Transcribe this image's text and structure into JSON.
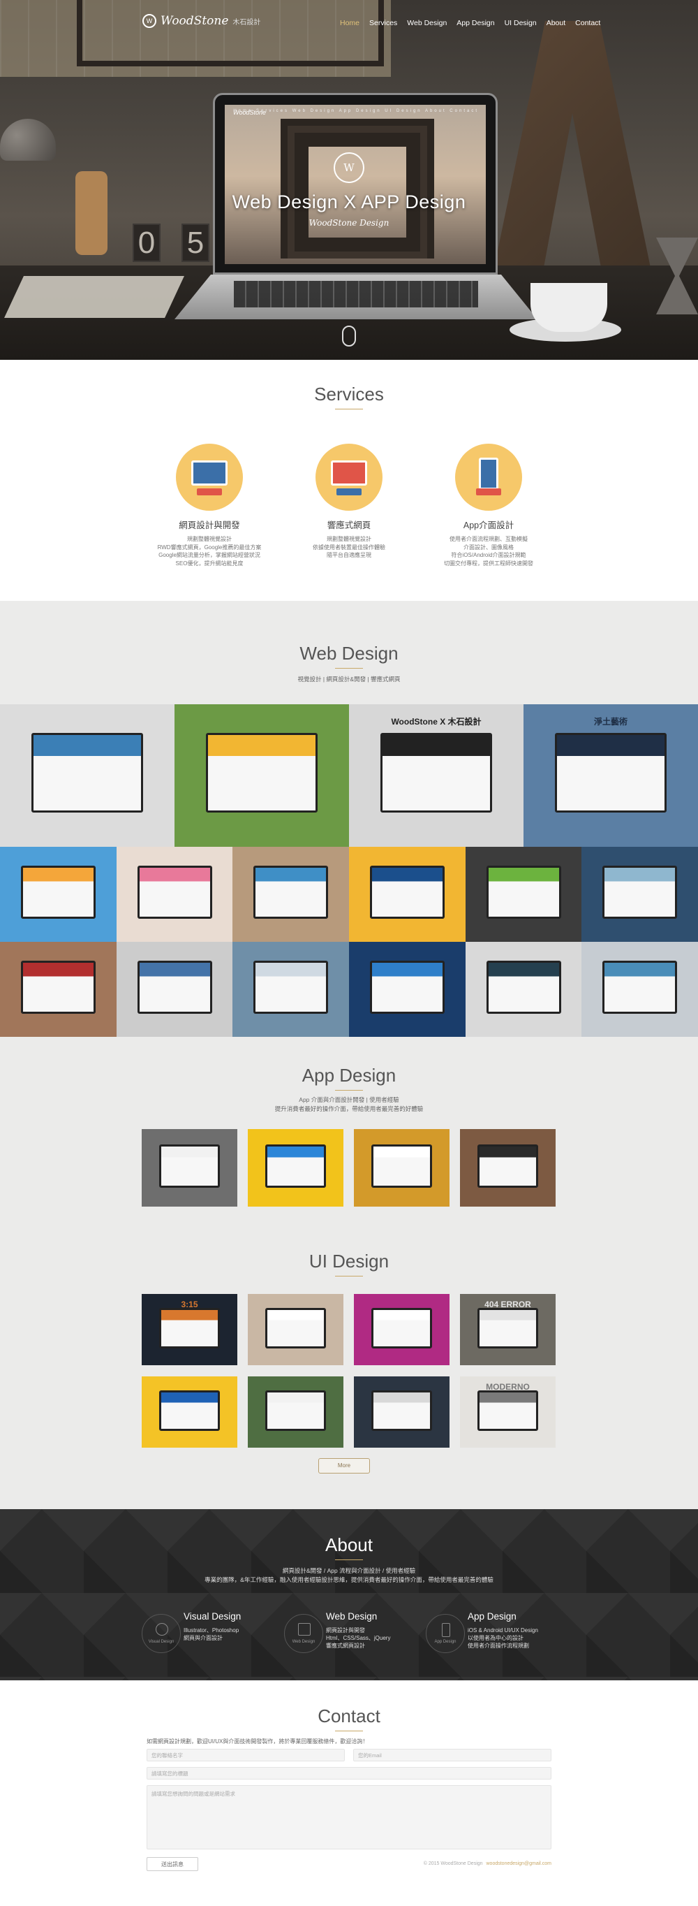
{
  "brand": {
    "name": "WoodStone",
    "sub": "木石設計"
  },
  "nav": [
    "Home",
    "Services",
    "Web Design",
    "App Design",
    "UI Design",
    "About",
    "Contact"
  ],
  "hero": {
    "title": "Web Design  X  APP Design",
    "subtitle": "WoodStone Design",
    "cube_digits": [
      "0",
      "5"
    ],
    "screen_nav": "Home  Services  Web Design  App Design  UI Design  About  Contact"
  },
  "services": {
    "title": "Services",
    "items": [
      {
        "name": "網頁設計與開發",
        "lines": [
          "規劃整體視覺設計",
          "RWD響應式網頁，Google推薦的最佳方案",
          "Google網站流量分析，掌握網站經營狀況",
          "SEO優化，提升網站能見度"
        ],
        "colors": [
          "#f6c86a",
          "#3b6fa8",
          "#e05548"
        ]
      },
      {
        "name": "響應式網頁",
        "lines": [
          "規劃整體視覺設計",
          "依據使用者裝置最佳操作體驗",
          "隨平台自適應呈現"
        ],
        "colors": [
          "#f6c86a",
          "#e05548",
          "#3b6fa8"
        ]
      },
      {
        "name": "App介面設計",
        "lines": [
          "使用者介面流程規劃、互動模擬",
          "介面設計、圖像風格",
          "符合iOS/Android介面設計規範",
          "切圖交付專程，提供工程師快速開發"
        ],
        "colors": [
          "#f6c86a",
          "#3b6fa8",
          "#e05548"
        ]
      }
    ]
  },
  "web_design": {
    "title": "Web Design",
    "desc": "視覺設計 | 網頁設計&開發 | 響應式網頁",
    "row1": [
      {
        "bg": "#dcdcdc",
        "accent": "#3b7fb6",
        "screen_text": ""
      },
      {
        "bg": "#6c9a45",
        "accent": "#f2b632",
        "screen_text": ""
      },
      {
        "bg": "#d7d7d7",
        "accent": "#222222",
        "screen_text": "WoodStone X 木石設計"
      },
      {
        "bg": "#5b7fa4",
        "accent": "#1f2f46",
        "screen_text": "淨土藝術"
      }
    ],
    "row2": [
      {
        "bg": "#4e9fd8",
        "accent": "#f4a63a"
      },
      {
        "bg": "#e9dcd2",
        "accent": "#e8799a"
      },
      {
        "bg": "#b79a7c",
        "accent": "#3f8fc6"
      },
      {
        "bg": "#f2b632",
        "accent": "#1b4f8c"
      },
      {
        "bg": "#3c3c3c",
        "accent": "#6cb33e"
      },
      {
        "bg": "#2f4f6f",
        "accent": "#8fb7cf"
      }
    ],
    "row3": [
      {
        "bg": "#a1765a",
        "accent": "#b22f2f"
      },
      {
        "bg": "#cccccc",
        "accent": "#4473a8"
      },
      {
        "bg": "#6f8fa8",
        "accent": "#cfd9e2"
      },
      {
        "bg": "#1a3d6b",
        "accent": "#2f7fc9"
      },
      {
        "bg": "#d9d9d9",
        "accent": "#25404f"
      },
      {
        "bg": "#c6ccd2",
        "accent": "#4a8db8"
      }
    ]
  },
  "app_design": {
    "title": "App Design",
    "desc": [
      "App 介面與介面設計開發 | 使用者經驗",
      "提升消費者最好的操作介面，帶給使用者最完善的好體驗"
    ],
    "tiles": [
      {
        "bg": "#6e6e6e",
        "accent": "#f1f1f1"
      },
      {
        "bg": "#f2c31b",
        "accent": "#2c86d8"
      },
      {
        "bg": "#d39a2a",
        "accent": "#ffffff"
      },
      {
        "bg": "#7d5a42",
        "accent": "#2b2b2b"
      }
    ]
  },
  "ui_design": {
    "title": "UI Design",
    "tiles": [
      {
        "bg": "#1c2430",
        "accent": "#d8782e"
      },
      {
        "bg": "#c9b7a4",
        "accent": "#ffffff"
      },
      {
        "bg": "#b02a83",
        "accent": "#ffffff"
      },
      {
        "bg": "#6d6a62",
        "accent": "#e3e3e3"
      },
      {
        "bg": "#f4c326",
        "accent": "#1f62b6"
      },
      {
        "bg": "#4f6e42",
        "accent": "#f2f2f2"
      },
      {
        "bg": "#2b3542",
        "accent": "#d8d8d8"
      },
      {
        "bg": "#e4e2de",
        "accent": "#7a7a7a"
      }
    ],
    "tile_texts": [
      "3:15",
      "404 ERROR",
      "MODERNO"
    ],
    "more_label": "More"
  },
  "about": {
    "title": "About",
    "desc": [
      "網頁設計&開發 / App 流程與介面設計 / 使用者經驗",
      "專業的團隊，&年工作經驗，融入使用者經驗設計思維，提供消費者最好的操作介面，帶給使用者最完善的體驗"
    ],
    "cols": [
      {
        "head": "Visual Design",
        "icon_label": "Visual Design",
        "lines": [
          "Illustrator、Photoshop",
          "網頁與介面設計"
        ]
      },
      {
        "head": "Web Design",
        "icon_label": "Web Design",
        "lines": [
          "網頁設計與開發",
          "Html、CSS/Sass、jQuery",
          "響應式網頁設計"
        ]
      },
      {
        "head": "App Design",
        "icon_label": "App Design",
        "lines": [
          "iOS & Android UI/UX Design",
          "以使用者為中心的設計",
          "使用者介面操作流程規劃"
        ]
      }
    ]
  },
  "contact": {
    "title": "Contact",
    "note": "如需網頁設計規劃，歡迎UI/UX與介面技術開發製作，將於專業回覆服務條件，歡迎洽詢！",
    "name_placeholder": "您的聯絡名字",
    "email_placeholder": "您的Email",
    "subject_placeholder": "請填寫您的標題",
    "message_placeholder": "請填寫您想詢問的問題或是網站需求",
    "send_label": "送出訊息",
    "copyright": "© 2015 WoodStone Design",
    "email": "woodstonedesign@gmail.com"
  }
}
